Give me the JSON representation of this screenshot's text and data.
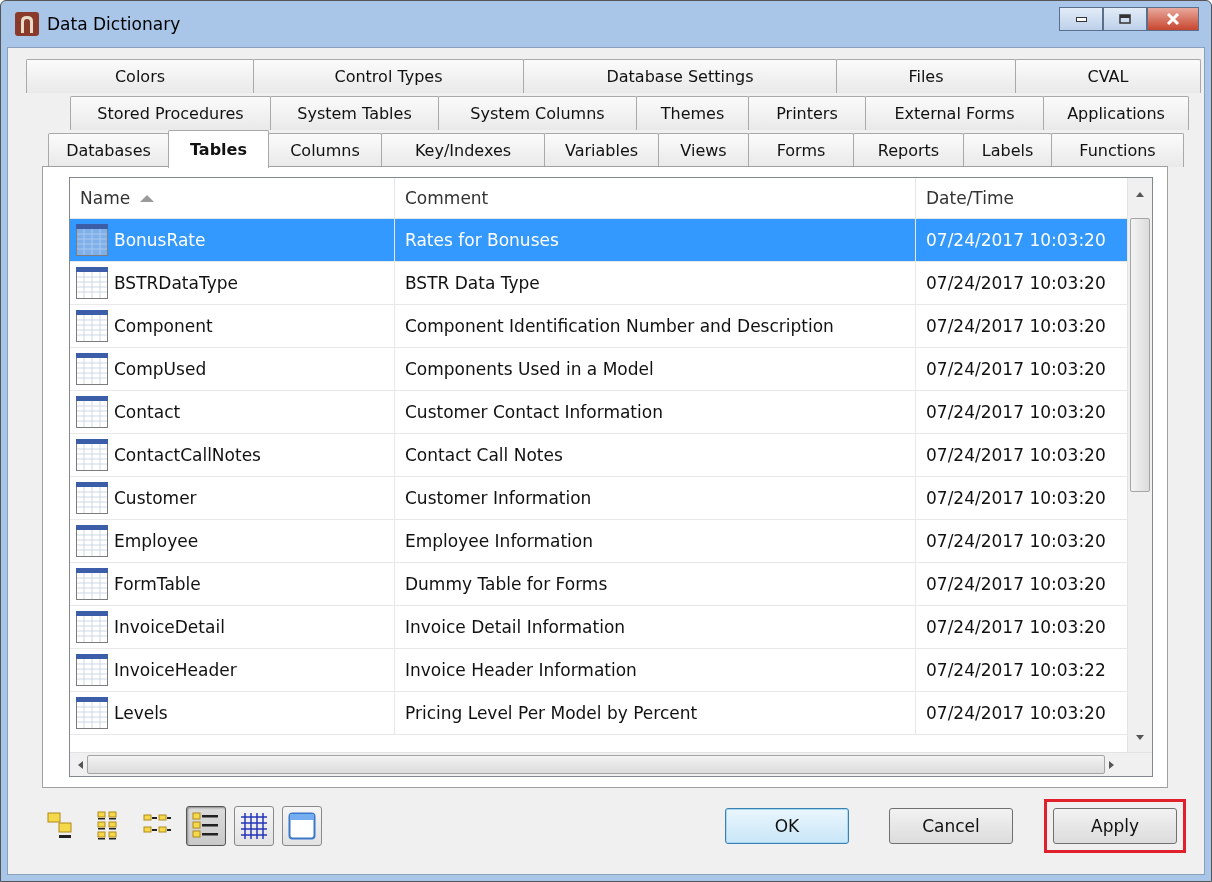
{
  "window": {
    "title": "Data Dictionary"
  },
  "tab_rows": [
    [
      {
        "label": "Colors",
        "selected": false
      },
      {
        "label": "Control Types",
        "selected": false
      },
      {
        "label": "Database Settings",
        "selected": false
      },
      {
        "label": "Files",
        "selected": false
      },
      {
        "label": "CVAL",
        "selected": false
      }
    ],
    [
      {
        "label": "Stored Procedures",
        "selected": false
      },
      {
        "label": "System Tables",
        "selected": false
      },
      {
        "label": "System Columns",
        "selected": false
      },
      {
        "label": "Themes",
        "selected": false
      },
      {
        "label": "Printers",
        "selected": false
      },
      {
        "label": "External Forms",
        "selected": false
      },
      {
        "label": "Applications",
        "selected": false
      }
    ],
    [
      {
        "label": "Databases",
        "selected": false
      },
      {
        "label": "Tables",
        "selected": true
      },
      {
        "label": "Columns",
        "selected": false
      },
      {
        "label": "Key/Indexes",
        "selected": false
      },
      {
        "label": "Variables",
        "selected": false
      },
      {
        "label": "Views",
        "selected": false
      },
      {
        "label": "Forms",
        "selected": false
      },
      {
        "label": "Reports",
        "selected": false
      },
      {
        "label": "Labels",
        "selected": false
      },
      {
        "label": "Functions",
        "selected": false
      }
    ]
  ],
  "table": {
    "columns": [
      {
        "label": "Name",
        "sorted": true
      },
      {
        "label": "Comment",
        "sorted": false
      },
      {
        "label": "Date/Time",
        "sorted": false
      }
    ],
    "rows": [
      {
        "name": "BonusRate",
        "comment": "Rates for Bonuses",
        "datetime": "07/24/2017 10:03:20",
        "selected": true
      },
      {
        "name": "BSTRDataType",
        "comment": "BSTR Data Type",
        "datetime": "07/24/2017 10:03:20",
        "selected": false
      },
      {
        "name": "Component",
        "comment": "Component Identification Number and Description",
        "datetime": "07/24/2017 10:03:20",
        "selected": false
      },
      {
        "name": "CompUsed",
        "comment": "Components Used in a Model",
        "datetime": "07/24/2017 10:03:20",
        "selected": false
      },
      {
        "name": "Contact",
        "comment": "Customer Contact Information",
        "datetime": "07/24/2017 10:03:20",
        "selected": false
      },
      {
        "name": "ContactCallNotes",
        "comment": "Contact Call Notes",
        "datetime": "07/24/2017 10:03:20",
        "selected": false
      },
      {
        "name": "Customer",
        "comment": "Customer Information",
        "datetime": "07/24/2017 10:03:20",
        "selected": false
      },
      {
        "name": "Employee",
        "comment": "Employee Information",
        "datetime": "07/24/2017 10:03:20",
        "selected": false
      },
      {
        "name": "FormTable",
        "comment": "Dummy Table for Forms",
        "datetime": "07/24/2017 10:03:20",
        "selected": false
      },
      {
        "name": "InvoiceDetail",
        "comment": "Invoice Detail Information",
        "datetime": "07/24/2017 10:03:20",
        "selected": false
      },
      {
        "name": "InvoiceHeader",
        "comment": "Invoice Header Information",
        "datetime": "07/24/2017 10:03:22",
        "selected": false
      },
      {
        "name": "Levels",
        "comment": "Pricing Level Per Model by Percent",
        "datetime": "07/24/2017 10:03:20",
        "selected": false
      }
    ]
  },
  "view_buttons": [
    {
      "kind": "large-icons",
      "selected": false
    },
    {
      "kind": "small-icons",
      "selected": false
    },
    {
      "kind": "list",
      "selected": false
    },
    {
      "kind": "details",
      "selected": true
    },
    {
      "kind": "grid",
      "selected": false
    },
    {
      "kind": "window",
      "selected": false
    }
  ],
  "buttons": [
    {
      "label": "OK",
      "default": true,
      "highlighted": false
    },
    {
      "label": "Cancel",
      "default": false,
      "highlighted": false
    },
    {
      "label": "Apply",
      "default": false,
      "highlighted": true
    }
  ]
}
